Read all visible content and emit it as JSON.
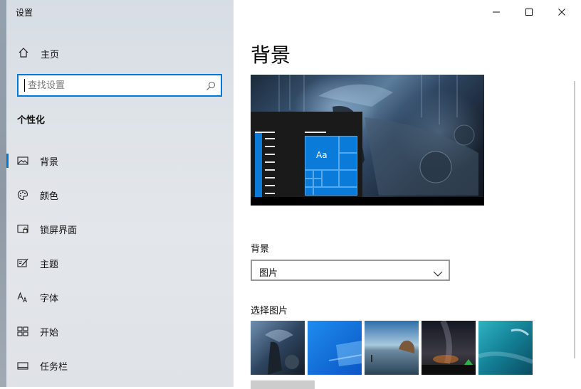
{
  "window": {
    "title": "设置"
  },
  "nav": {
    "home_label": "主页",
    "section_title": "个性化",
    "items": [
      {
        "label": "背景",
        "icon": "image-icon",
        "active": true
      },
      {
        "label": "颜色",
        "icon": "palette-icon",
        "active": false
      },
      {
        "label": "锁屏界面",
        "icon": "lock-screen-icon",
        "active": false
      },
      {
        "label": "主题",
        "icon": "theme-icon",
        "active": false
      },
      {
        "label": "字体",
        "icon": "font-icon",
        "active": false
      },
      {
        "label": "开始",
        "icon": "start-icon",
        "active": false
      },
      {
        "label": "任务栏",
        "icon": "taskbar-icon",
        "active": false
      }
    ]
  },
  "search": {
    "placeholder": "查找设置"
  },
  "main": {
    "page_title": "背景",
    "preview_tile_text": "Aa",
    "background_label": "背景",
    "background_select_value": "图片",
    "choose_picture_label": "选择图片",
    "thumbnails": [
      {
        "icon": "anime-rain-thumbnail"
      },
      {
        "icon": "windows-blue-thumbnail"
      },
      {
        "icon": "beach-rock-thumbnail"
      },
      {
        "icon": "night-sky-tent-thumbnail"
      },
      {
        "icon": "underwater-swimmer-thumbnail"
      }
    ]
  },
  "colors": {
    "accent": "#0078d7",
    "tile_blue": "#0a7bd9"
  }
}
